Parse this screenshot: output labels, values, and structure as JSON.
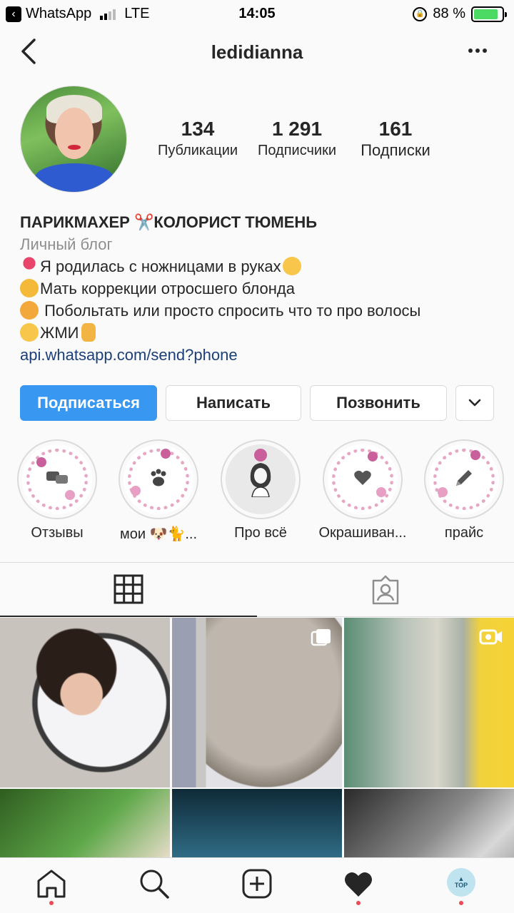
{
  "status_bar": {
    "app_back": "WhatsApp",
    "network": "LTE",
    "time": "14:05",
    "battery": "88 %",
    "battery_level": 0.88
  },
  "header": {
    "username": "ledidianna"
  },
  "stats": [
    {
      "value": "134",
      "label": "Публикации"
    },
    {
      "value": "1 291",
      "label": "Подписчики"
    },
    {
      "value": "161",
      "label": "Подписки"
    }
  ],
  "bio": {
    "name": "ПАРИКМАХЕР ✂️КОЛОРИСТ ТЮМЕНЬ",
    "category": "Личный блог",
    "line1": "Я родилась с ножницами в руках",
    "line2": "Мать коррекции отросшего блонда",
    "line3": " Побольтать или просто спросить что то про волосы",
    "line4": "ЖМИ",
    "link": "api.whatsapp.com/send?phone"
  },
  "buttons": {
    "follow": "Подписаться",
    "message": "Написать",
    "call": "Позвонить"
  },
  "highlights": [
    {
      "label": "Отзывы",
      "icon": "chat-bubbles-icon"
    },
    {
      "label": "мои 🐶🐈...",
      "icon": "paw-icon"
    },
    {
      "label": "Про всё",
      "icon": "girl-drawing-icon"
    },
    {
      "label": "Окрашиван...",
      "icon": "heart-icon"
    },
    {
      "label": "прайс",
      "icon": "pen-icon"
    }
  ],
  "tabs": [
    {
      "name": "grid",
      "icon": "grid-icon",
      "active": true
    },
    {
      "name": "tagged",
      "icon": "tagged-person-icon",
      "active": false
    }
  ],
  "bottom_nav": {
    "profile_badge": "TOP"
  },
  "colors": {
    "accent": "#3897f0",
    "link": "#1c3f7a",
    "notification_dot": "#ed4956",
    "battery_fill": "#4cd964"
  }
}
